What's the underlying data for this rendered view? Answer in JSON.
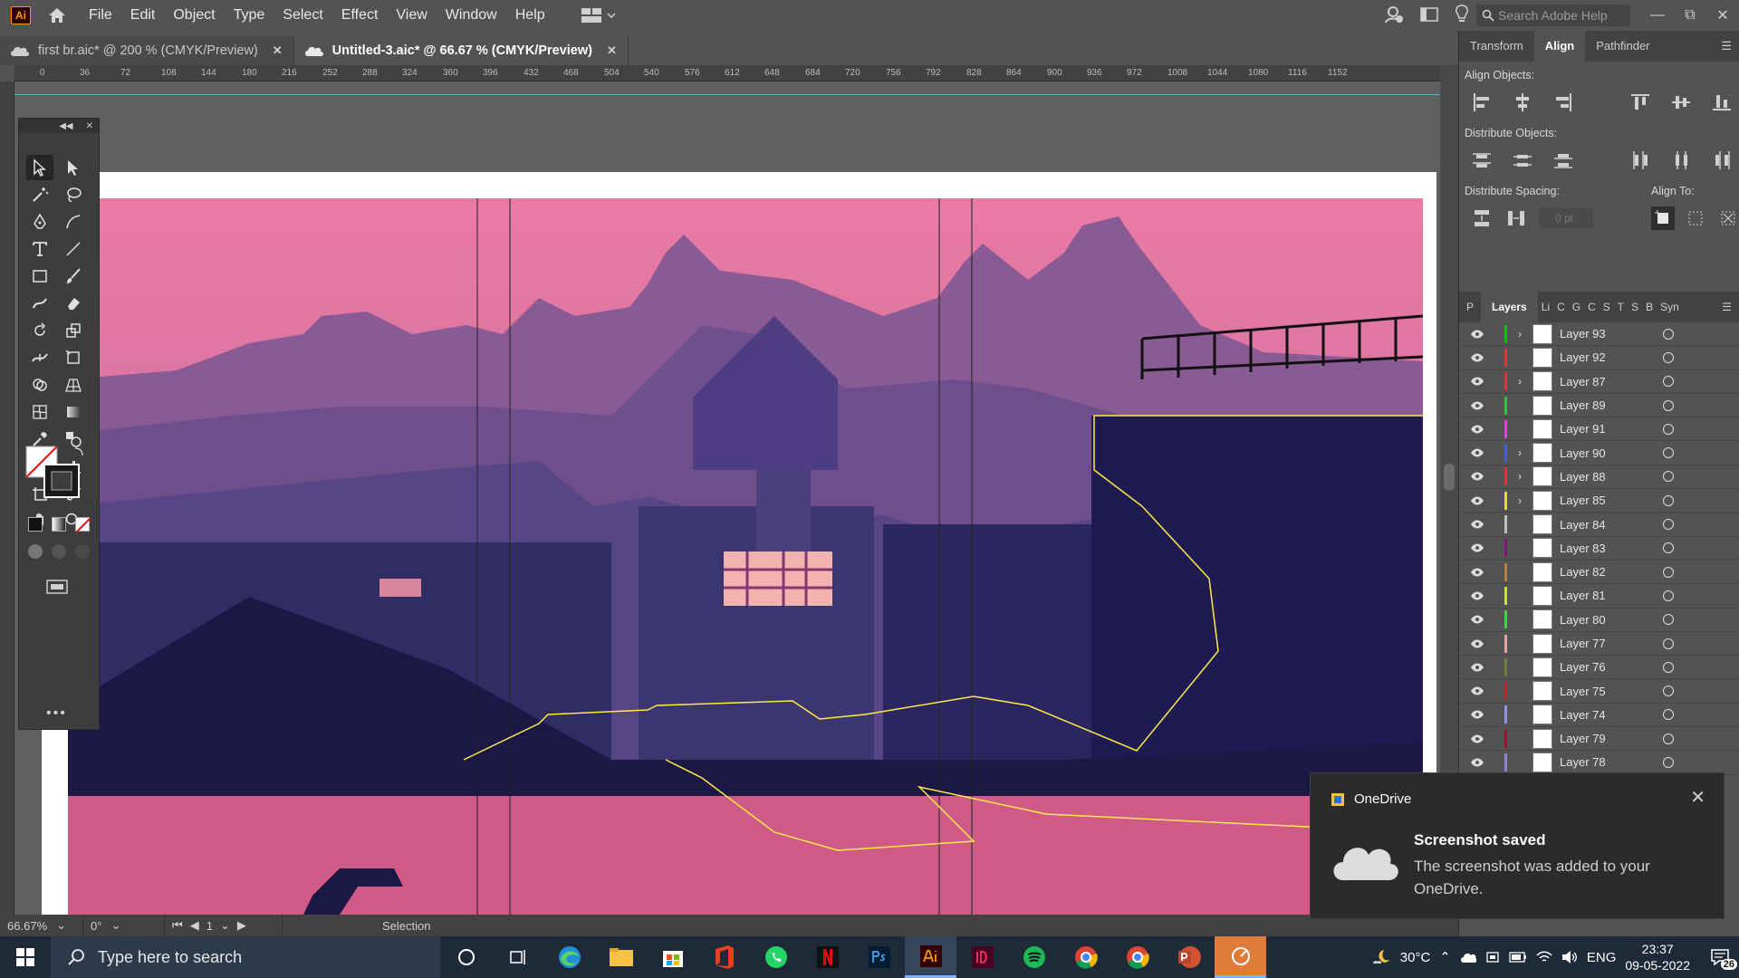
{
  "app": {
    "logo": "Ai"
  },
  "menu": [
    "File",
    "Edit",
    "Object",
    "Type",
    "Select",
    "Effect",
    "View",
    "Window",
    "Help"
  ],
  "search": {
    "placeholder": "Search Adobe Help"
  },
  "tabs": [
    {
      "label": "first br.aic* @ 200 % (CMYK/Preview)",
      "active": false
    },
    {
      "label": "Untitled-3.aic* @ 66.67 % (CMYK/Preview)",
      "active": true
    }
  ],
  "ruler": [
    "0",
    "36",
    "72",
    "108",
    "144",
    "180",
    "216",
    "252",
    "288",
    "324",
    "360",
    "396",
    "432",
    "468",
    "504",
    "540",
    "576",
    "612",
    "648",
    "684",
    "720",
    "756",
    "792",
    "828",
    "864",
    "900",
    "936",
    "972",
    "1008",
    "1044",
    "1080",
    "1116",
    "1152"
  ],
  "status": {
    "zoom": "66.67%",
    "rotation": "0°",
    "artboard": "1",
    "tool": "Selection"
  },
  "align_panel": {
    "tabs": [
      "Transform",
      "Align",
      "Pathfinder"
    ],
    "align_objects": "Align Objects:",
    "distribute_objects": "Distribute Objects:",
    "distribute_spacing": "Distribute Spacing:",
    "align_to": "Align To:",
    "spacing_value": "0 pt"
  },
  "layers_panel": {
    "tabs": [
      "P",
      "Layers",
      "Li",
      "C",
      "G",
      "C",
      "S",
      "T",
      "S",
      "B",
      "Syn"
    ],
    "layers": [
      {
        "name": "Layer 93",
        "color": "#00c800",
        "expandable": true
      },
      {
        "name": "Layer 92",
        "color": "#e83030",
        "expandable": false
      },
      {
        "name": "Layer 87",
        "color": "#e83030",
        "expandable": true
      },
      {
        "name": "Layer 89",
        "color": "#2ec82e",
        "expandable": false
      },
      {
        "name": "Layer 91",
        "color": "#e040e0",
        "expandable": false
      },
      {
        "name": "Layer 90",
        "color": "#4060e8",
        "expandable": true
      },
      {
        "name": "Layer 88",
        "color": "#e83030",
        "expandable": true
      },
      {
        "name": "Layer 85",
        "color": "#e8e020",
        "expandable": true
      },
      {
        "name": "Layer 84",
        "color": "#c0c0c0",
        "expandable": false
      },
      {
        "name": "Layer 83",
        "color": "#8a1080",
        "expandable": false
      },
      {
        "name": "Layer 82",
        "color": "#c08030",
        "expandable": false
      },
      {
        "name": "Layer 81",
        "color": "#c8e030",
        "expandable": false
      },
      {
        "name": "Layer 80",
        "color": "#30e030",
        "expandable": false
      },
      {
        "name": "Layer 77",
        "color": "#f0a0a0",
        "expandable": false
      },
      {
        "name": "Layer 76",
        "color": "#708030",
        "expandable": false
      },
      {
        "name": "Layer 75",
        "color": "#c02020",
        "expandable": false
      },
      {
        "name": "Layer 74",
        "color": "#9090f0",
        "expandable": false
      },
      {
        "name": "Layer 79",
        "color": "#a01020",
        "expandable": false
      },
      {
        "name": "Layer 78",
        "color": "#9080e0",
        "expandable": false
      }
    ]
  },
  "notification": {
    "app": "OneDrive",
    "title": "Screenshot saved",
    "message": "The screenshot was added to your OneDrive."
  },
  "taskbar": {
    "search_placeholder": "Type here to search",
    "weather": "30°C",
    "language": "ENG",
    "time": "23:37",
    "date": "09-05-2022",
    "notifications": "26"
  }
}
